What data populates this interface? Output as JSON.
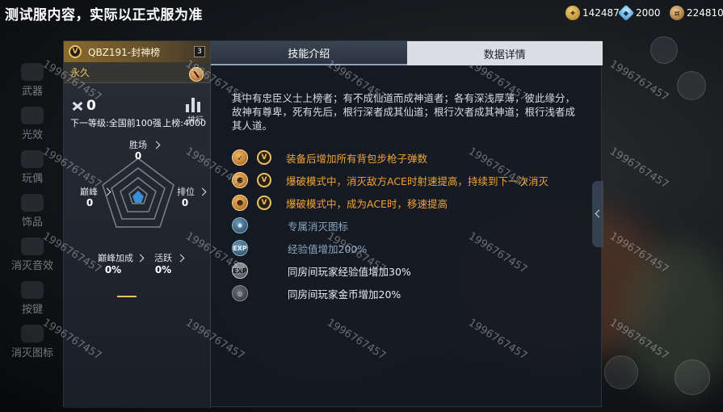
{
  "header": {
    "title": "测试服内容，实际以正式服为准"
  },
  "currencies": [
    {
      "icon": "gold-coin-icon",
      "value": "142487"
    },
    {
      "icon": "diamond-icon",
      "value": "2000"
    },
    {
      "icon": "coin-icon",
      "value": "224810"
    }
  ],
  "nav": [
    {
      "label": "武器"
    },
    {
      "label": "光效"
    },
    {
      "label": "玩偶"
    },
    {
      "label": "饰品"
    },
    {
      "label": "消灭音效"
    },
    {
      "label": "按键"
    },
    {
      "label": "消灭图标"
    }
  ],
  "card": {
    "badge": "V",
    "name": "QBZ191-封神榜",
    "count": "3",
    "duration": "永久",
    "kills": "0",
    "rank_label": "排行",
    "next_tier": "下一等级:全国前100强",
    "rank_up": "上榜:4000",
    "stats": {
      "wins": {
        "label": "胜场",
        "value": "0"
      },
      "peak": {
        "label": "巅峰",
        "value": "0"
      },
      "rank": {
        "label": "排位",
        "value": "0"
      },
      "peak_bonus": {
        "label": "巅峰加成",
        "value": "0%"
      },
      "active": {
        "label": "活跃",
        "value": "0%"
      }
    }
  },
  "tabs": [
    {
      "label": "技能介绍",
      "active": true
    },
    {
      "label": "数据详情",
      "active": false
    }
  ],
  "description": "其中有忠臣义士上榜者；有不成仙道而成神道者；各有深浅厚薄，彼此缘分，故神有尊卑，死有先后，根行深者成其仙道；根行次者成其神道；根行浅者成其人道。",
  "attributes": [
    {
      "icon": "bullet-icon",
      "style": "gold",
      "badge": "V",
      "text": "装备后增加所有背包步枪子弹数",
      "color": "#f1a338"
    },
    {
      "icon": "ace-icon",
      "style": "gold",
      "badge": "V",
      "text": "爆破模式中，消灭敌方ACE时射速提高，持续到下一次消灭",
      "color": "#f1a338"
    },
    {
      "icon": "run-icon",
      "style": "gold",
      "badge": "V",
      "text": "爆破模式中，成为ACE时，移速提高",
      "color": "#f1a338"
    },
    {
      "icon": "kill-mark-icon",
      "style": "blue",
      "badge": "",
      "text": "专属消灭图标",
      "color": "#8aa6c0"
    },
    {
      "icon": "exp-icon",
      "style": "blue",
      "badge": "",
      "text": "经验值增加200%",
      "color": "#8aa6c0"
    },
    {
      "icon": "exp-icon",
      "style": "grey",
      "badge": "",
      "text": "同房间玩家经验值增加30%",
      "color": "#e8ecf0"
    },
    {
      "icon": "coin-icon",
      "style": "gray2",
      "badge": "",
      "text": "同房间玩家金币增加20%",
      "color": "#e8ecf0"
    }
  ],
  "watermark": "1996767457"
}
